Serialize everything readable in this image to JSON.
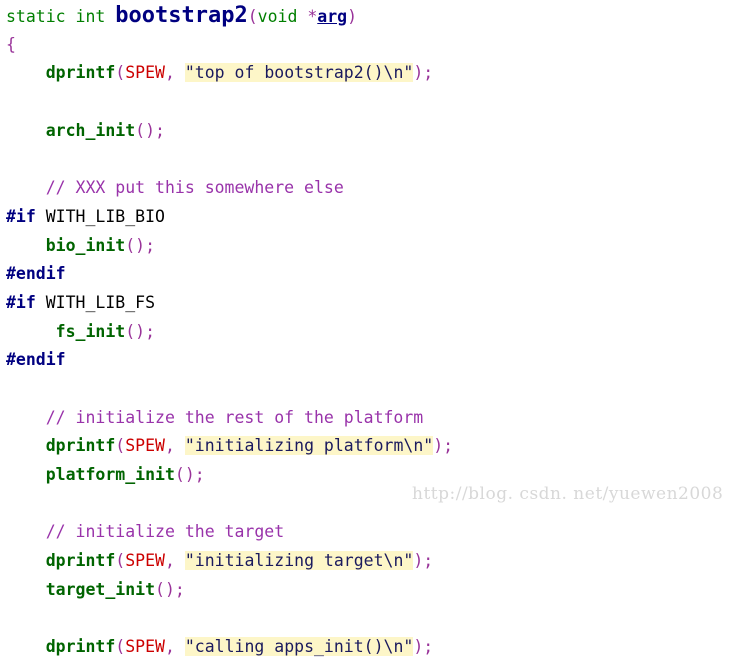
{
  "meta": {
    "background_color": "#ffffff",
    "language": "c",
    "title": "bootstrap2 source listing"
  },
  "colors": {
    "keyword": "#007f00",
    "function": "#006400",
    "function_definition": "#000080",
    "punctuation": "#993399",
    "constant": "#cc0000",
    "comment": "#9933aa",
    "preprocessor": "#000080",
    "string_text": "#1a1a5e",
    "string_highlight": "#fdf6c8",
    "plain": "#000000",
    "watermark": "#d8d8d8"
  },
  "watermark": {
    "text": "http://blog. csdn. net/yuewen2008"
  },
  "code": {
    "lines": [
      {
        "n": 1,
        "text": "static int bootstrap2(void *arg)",
        "tokens": [
          {
            "t": "static int ",
            "c": "kw"
          },
          {
            "t": "bootstrap2",
            "c": "fnbig"
          },
          {
            "t": "(",
            "c": "punc"
          },
          {
            "t": "void ",
            "c": "kw"
          },
          {
            "t": "*",
            "c": "punc"
          },
          {
            "t": "arg",
            "c": "macroarg"
          },
          {
            "t": ")",
            "c": "punc"
          }
        ]
      },
      {
        "n": 2,
        "text": "{",
        "tokens": [
          {
            "t": "{",
            "c": "brace"
          }
        ]
      },
      {
        "n": 3,
        "text": "    dprintf(SPEW, \"top of bootstrap2()\\n\");",
        "tokens": [
          {
            "t": "    ",
            "c": "plain"
          },
          {
            "t": "dprintf",
            "c": "fn"
          },
          {
            "t": "(",
            "c": "punc"
          },
          {
            "t": "SPEW",
            "c": "const"
          },
          {
            "t": ", ",
            "c": "punc"
          },
          {
            "t": "\"top of bootstrap2()\\n\"",
            "c": "str"
          },
          {
            "t": ")",
            "c": "punc"
          },
          {
            "t": ";",
            "c": "punc"
          }
        ]
      },
      {
        "n": 4,
        "text": "",
        "tokens": []
      },
      {
        "n": 5,
        "text": "    arch_init();",
        "tokens": [
          {
            "t": "    ",
            "c": "plain"
          },
          {
            "t": "arch_init",
            "c": "fn"
          },
          {
            "t": "()",
            "c": "punc"
          },
          {
            "t": ";",
            "c": "punc"
          }
        ]
      },
      {
        "n": 6,
        "text": "",
        "tokens": []
      },
      {
        "n": 7,
        "text": "    // XXX put this somewhere else",
        "tokens": [
          {
            "t": "    ",
            "c": "plain"
          },
          {
            "t": "// XXX put this somewhere else",
            "c": "comment"
          }
        ]
      },
      {
        "n": 8,
        "text": "#if WITH_LIB_BIO",
        "tokens": [
          {
            "t": "#if",
            "c": "pp"
          },
          {
            "t": " WITH_LIB_BIO",
            "c": "ppid"
          }
        ]
      },
      {
        "n": 9,
        "text": "    bio_init();",
        "tokens": [
          {
            "t": "    ",
            "c": "plain"
          },
          {
            "t": "bio_init",
            "c": "fn"
          },
          {
            "t": "()",
            "c": "punc"
          },
          {
            "t": ";",
            "c": "punc"
          }
        ]
      },
      {
        "n": 10,
        "text": "#endif",
        "tokens": [
          {
            "t": "#endif",
            "c": "pp"
          }
        ]
      },
      {
        "n": 11,
        "text": "#if WITH_LIB_FS",
        "tokens": [
          {
            "t": "#if",
            "c": "pp"
          },
          {
            "t": " WITH_LIB_FS",
            "c": "ppid"
          }
        ]
      },
      {
        "n": 12,
        "text": "    fs_init();",
        "tokens": [
          {
            "t": "     ",
            "c": "plain"
          },
          {
            "t": "fs_init",
            "c": "fn"
          },
          {
            "t": "()",
            "c": "punc"
          },
          {
            "t": ";",
            "c": "punc"
          }
        ]
      },
      {
        "n": 13,
        "text": "#endif",
        "tokens": [
          {
            "t": "#endif",
            "c": "pp"
          }
        ]
      },
      {
        "n": 14,
        "text": "",
        "tokens": []
      },
      {
        "n": 15,
        "text": "    // initialize the rest of the platform",
        "tokens": [
          {
            "t": "    ",
            "c": "plain"
          },
          {
            "t": "// initialize the rest of the platform",
            "c": "comment"
          }
        ]
      },
      {
        "n": 16,
        "text": "    dprintf(SPEW, \"initializing platform\\n\");",
        "tokens": [
          {
            "t": "    ",
            "c": "plain"
          },
          {
            "t": "dprintf",
            "c": "fn"
          },
          {
            "t": "(",
            "c": "punc"
          },
          {
            "t": "SPEW",
            "c": "const"
          },
          {
            "t": ", ",
            "c": "punc"
          },
          {
            "t": "\"initializing platform\\n\"",
            "c": "str"
          },
          {
            "t": ")",
            "c": "punc"
          },
          {
            "t": ";",
            "c": "punc"
          }
        ]
      },
      {
        "n": 17,
        "text": "    platform_init();",
        "tokens": [
          {
            "t": "    ",
            "c": "plain"
          },
          {
            "t": "platform_init",
            "c": "fn"
          },
          {
            "t": "()",
            "c": "punc"
          },
          {
            "t": ";",
            "c": "punc"
          }
        ]
      },
      {
        "n": 18,
        "text": "",
        "tokens": []
      },
      {
        "n": 19,
        "text": "    // initialize the target",
        "tokens": [
          {
            "t": "    ",
            "c": "plain"
          },
          {
            "t": "// initialize the target",
            "c": "comment"
          }
        ]
      },
      {
        "n": 20,
        "text": "    dprintf(SPEW, \"initializing target\\n\");",
        "tokens": [
          {
            "t": "    ",
            "c": "plain"
          },
          {
            "t": "dprintf",
            "c": "fn"
          },
          {
            "t": "(",
            "c": "punc"
          },
          {
            "t": "SPEW",
            "c": "const"
          },
          {
            "t": ", ",
            "c": "punc"
          },
          {
            "t": "\"initializing target\\n\"",
            "c": "str"
          },
          {
            "t": ")",
            "c": "punc"
          },
          {
            "t": ";",
            "c": "punc"
          }
        ]
      },
      {
        "n": 21,
        "text": "    target_init();",
        "tokens": [
          {
            "t": "    ",
            "c": "plain"
          },
          {
            "t": "target_init",
            "c": "fn"
          },
          {
            "t": "()",
            "c": "punc"
          },
          {
            "t": ";",
            "c": "punc"
          }
        ]
      },
      {
        "n": 22,
        "text": "",
        "tokens": []
      },
      {
        "n": 23,
        "text": "    dprintf(SPEW, \"calling apps_init()\\n\");",
        "tokens": [
          {
            "t": "    ",
            "c": "plain"
          },
          {
            "t": "dprintf",
            "c": "fn"
          },
          {
            "t": "(",
            "c": "punc"
          },
          {
            "t": "SPEW",
            "c": "const"
          },
          {
            "t": ", ",
            "c": "punc"
          },
          {
            "t": "\"calling apps_init()\\n\"",
            "c": "str"
          },
          {
            "t": ")",
            "c": "punc"
          },
          {
            "t": ";",
            "c": "punc"
          }
        ]
      }
    ]
  }
}
